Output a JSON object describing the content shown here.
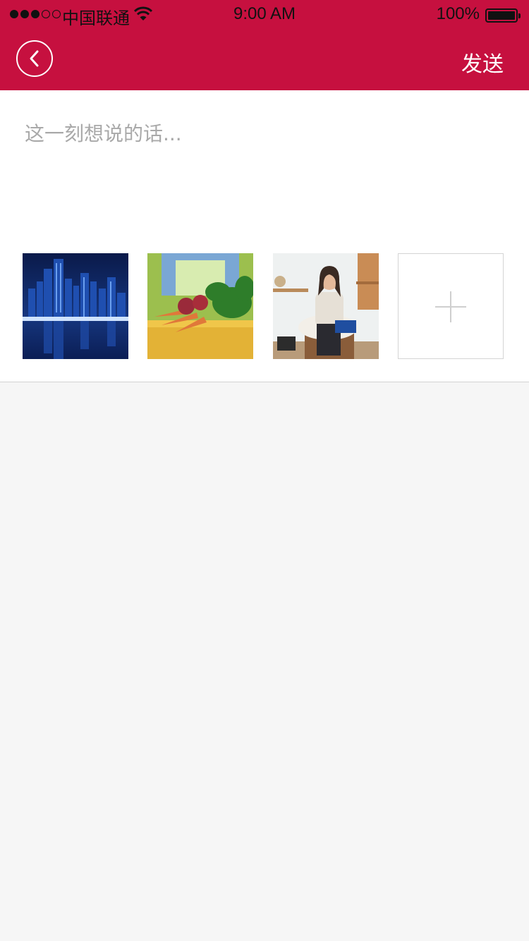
{
  "status_bar": {
    "carrier": "中国联通",
    "time": "9:00 AM",
    "battery_percent": "100%",
    "signal_bars_filled": 3,
    "signal_bars_total": 5,
    "battery_level": 1.0
  },
  "nav": {
    "back_icon": "chevron-left-circle-icon",
    "send_label": "发送"
  },
  "compose": {
    "placeholder": "这一刻想说的话...",
    "value": ""
  },
  "photos": [
    {
      "name": "city-skyline-photo"
    },
    {
      "name": "vegetables-photo"
    },
    {
      "name": "woman-portrait-photo"
    }
  ],
  "add_photo": {
    "icon": "plus-icon"
  },
  "colors": {
    "brand": "#c6103f",
    "background": "#f6f6f6"
  }
}
